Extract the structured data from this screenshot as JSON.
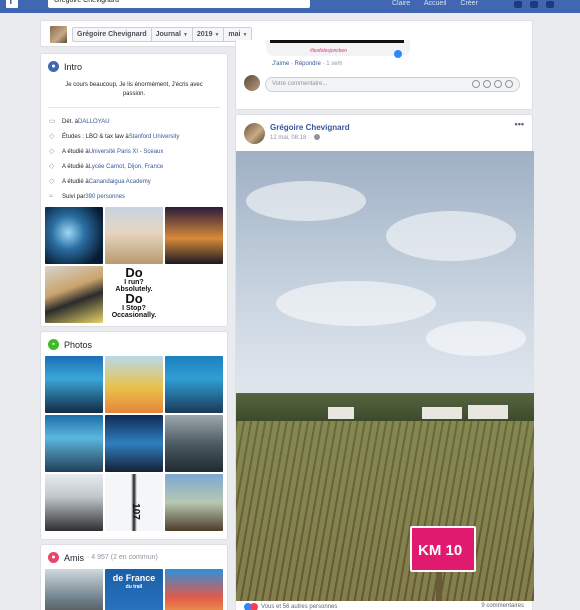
{
  "topbar": {
    "search_value": "Grégoire Chevignard",
    "nav_links": [
      "Claire",
      "Accueil",
      "Créer"
    ]
  },
  "selector": {
    "crumbs": [
      {
        "label": "Grégoire Chevignard"
      },
      {
        "label": "Journal"
      },
      {
        "label": "2019"
      },
      {
        "label": "mai"
      }
    ]
  },
  "intro": {
    "title": "Intro",
    "bio": "Je cours beaucoup, Je lis énormément, J'écris avec passion.",
    "items": [
      {
        "icon": "briefcase-icon",
        "prefix": "Dét. à ",
        "link": "DALLOYAU",
        "suffix": ""
      },
      {
        "icon": "graduation-cap-icon",
        "prefix": "Études : LBO & tax law à ",
        "link": "Stanford University",
        "suffix": ""
      },
      {
        "icon": "graduation-cap-icon",
        "prefix": "A étudié à ",
        "link": "Université Paris XI - Sceaux",
        "suffix": ""
      },
      {
        "icon": "graduation-cap-icon",
        "prefix": "A étudié à ",
        "link": "Lycée Carnot, Dijon, France",
        "suffix": ""
      },
      {
        "icon": "graduation-cap-icon",
        "prefix": "A étudié à ",
        "link": "Canandaigua Academy",
        "suffix": ""
      },
      {
        "icon": "rss-icon",
        "prefix": "Suivi par ",
        "link": "390 personnes",
        "suffix": ""
      }
    ],
    "featured_text": {
      "do_line1": "Do",
      "do_line2": "I run?",
      "do_line3": "Absolutely.",
      "do_line4": "Do",
      "do_line5": "I Stop?",
      "do_line6": "Occasionally."
    }
  },
  "photos": {
    "title": "Photos",
    "bib_number": "107"
  },
  "friends": {
    "title": "Amis",
    "count": "· 4 957 (2 en commun)",
    "tile_text_1": "de France",
    "tile_text_2": "du trail"
  },
  "comment": {
    "hashtag": "#lesfolesjoncken",
    "like_label": "J'aime",
    "reply_label": "Répondre",
    "time": "1 sem",
    "input_placeholder": "Votre commentaire..."
  },
  "post": {
    "author": "Grégoire Chevignard",
    "meta": "12 mai, 08:18 ·",
    "more": "•••",
    "sign_text": "KM 10",
    "reactions_text": "Vous et 56 autres personnes",
    "comments_text": "9 commentaires"
  },
  "colors": {
    "brand": "#4267b2",
    "link": "#385898",
    "background": "#e9ebee"
  }
}
